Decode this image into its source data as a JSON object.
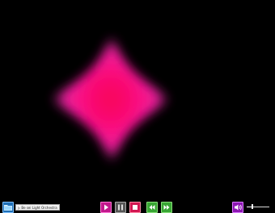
{
  "player": {
    "track_label": "▷ Be sei Light Orchestra"
  },
  "controls": {
    "folder_icon": "folder-icon",
    "play_icon": "play-icon",
    "pause_icon": "pause-icon",
    "stop_icon": "stop-icon",
    "rewind_icon": "rewind-icon",
    "fast_forward_icon": "fast-forward-icon",
    "volume_icon": "volume-icon"
  },
  "volume": {
    "level": 0.26
  },
  "colors": {
    "background": "#000000",
    "glow_core": "#ff0066",
    "glow_edge": "#ff1aa6"
  }
}
